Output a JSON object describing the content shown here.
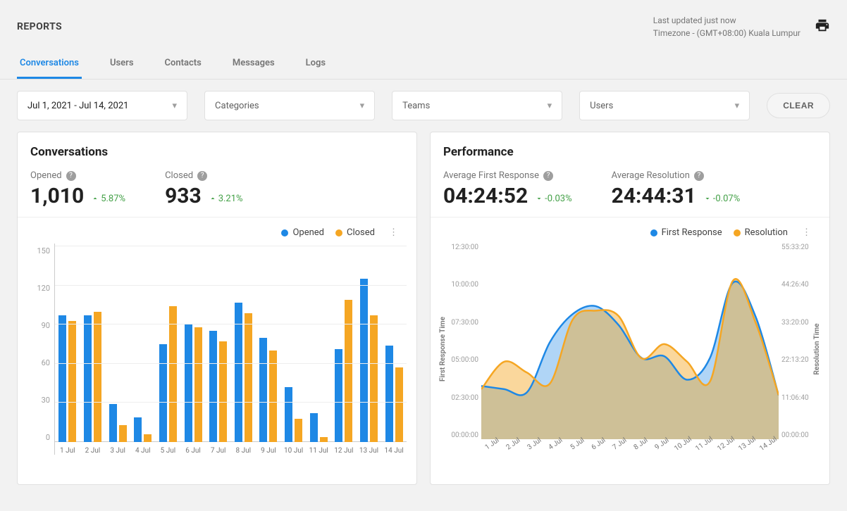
{
  "header": {
    "title": "REPORTS",
    "last_updated": "Last updated just now",
    "timezone": "Timezone - (GMT+08:00) Kuala Lumpur"
  },
  "tabs": [
    {
      "label": "Conversations",
      "active": true
    },
    {
      "label": "Users",
      "active": false
    },
    {
      "label": "Contacts",
      "active": false
    },
    {
      "label": "Messages",
      "active": false
    },
    {
      "label": "Logs",
      "active": false
    }
  ],
  "filters": {
    "date_range": "Jul 1, 2021 - Jul 14, 2021",
    "categories_placeholder": "Categories",
    "teams_placeholder": "Teams",
    "users_placeholder": "Users",
    "clear_label": "CLEAR"
  },
  "colors": {
    "blue": "#1e88e5",
    "orange": "#f5a623",
    "green": "#43a047"
  },
  "conversations_card": {
    "title": "Conversations",
    "metrics": {
      "opened": {
        "label": "Opened",
        "value": "1,010",
        "delta": "5.87%",
        "direction": "up"
      },
      "closed": {
        "label": "Closed",
        "value": "933",
        "delta": "3.21%",
        "direction": "up"
      }
    },
    "legend": {
      "opened": "Opened",
      "closed": "Closed"
    }
  },
  "performance_card": {
    "title": "Performance",
    "metrics": {
      "first_response": {
        "label": "Average First Response",
        "value": "04:24:52",
        "delta": "-0.03%",
        "direction": "down"
      },
      "resolution": {
        "label": "Average Resolution",
        "value": "24:44:31",
        "delta": "-0.07%",
        "direction": "down"
      }
    },
    "legend": {
      "first_response": "First Response",
      "resolution": "Resolution"
    },
    "y1_label": "First Response Time",
    "y2_label": "Resolution Time"
  },
  "chart_data": [
    {
      "type": "bar",
      "title": "Conversations",
      "categories": [
        "1 Jul",
        "2 Jul",
        "3 Jul",
        "4 Jul",
        "5 Jul",
        "6 Jul",
        "7 Jul",
        "8 Jul",
        "9 Jul",
        "10 Jul",
        "11 Jul",
        "12 Jul",
        "13 Jul",
        "14 Jul"
      ],
      "series": [
        {
          "name": "Opened",
          "color": "#1e88e5",
          "values": [
            97,
            97,
            29,
            19,
            75,
            90,
            85,
            107,
            80,
            42,
            22,
            71,
            125,
            74
          ]
        },
        {
          "name": "Closed",
          "color": "#f5a623",
          "values": [
            93,
            100,
            13,
            6,
            104,
            88,
            77,
            99,
            70,
            18,
            4,
            109,
            97,
            57
          ]
        }
      ],
      "ylim": [
        0,
        150
      ],
      "yticks": [
        0,
        30,
        60,
        90,
        120,
        150
      ],
      "ylabel": "",
      "xlabel": ""
    },
    {
      "type": "area",
      "title": "Performance",
      "categories": [
        "1 Jul",
        "2 Jul",
        "3 Jul",
        "4 Jul",
        "5 Jul",
        "6 Jul",
        "7 Jul",
        "8 Jul",
        "9 Jul",
        "10 Jul",
        "11 Jul",
        "12 Jul",
        "13 Jul",
        "14 Jul"
      ],
      "series": [
        {
          "name": "First Response",
          "axis": "left",
          "color": "#1e88e5",
          "values_hours": [
            3.4,
            3.2,
            3.0,
            6.2,
            8.0,
            8.5,
            7.3,
            5.2,
            5.3,
            3.8,
            5.2,
            10.0,
            7.8,
            2.8
          ]
        },
        {
          "name": "Resolution",
          "axis": "right",
          "color": "#f5a623",
          "values_hours": [
            14.2,
            22.0,
            18.9,
            15.8,
            34.0,
            36.5,
            35.0,
            23.0,
            27.0,
            22.0,
            16.4,
            45.0,
            33.0,
            12.5
          ]
        }
      ],
      "y1_ticks": [
        "12:30:00",
        "10:00:00",
        "07:30:00",
        "05:00:00",
        "02:30:00",
        "00:00:00"
      ],
      "y1_range_hours": [
        0,
        12.5
      ],
      "y1_label": "First Response Time",
      "y2_ticks": [
        "55:33:20",
        "44:26:40",
        "33:20:00",
        "22:13:20",
        "11:06:40",
        "00:00:00"
      ],
      "y2_range_hours": [
        0,
        55.56
      ],
      "y2_label": "Resolution Time"
    }
  ]
}
